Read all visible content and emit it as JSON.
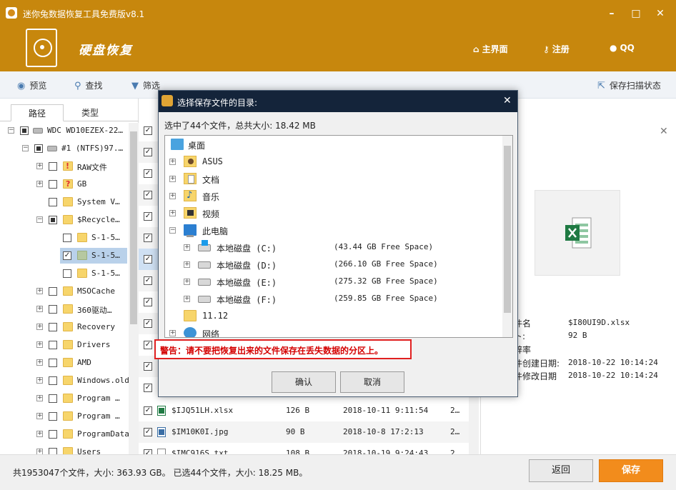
{
  "window": {
    "title": "迷你兔数据恢复工具免费版v8.1",
    "min_glyph": "–",
    "max_glyph": "□",
    "close_glyph": "✕"
  },
  "header": {
    "brand": "硬盘恢复",
    "nav": [
      {
        "label": "主界面",
        "icon": "home-icon"
      },
      {
        "label": "注册",
        "icon": "key-icon"
      },
      {
        "label": "QQ",
        "icon": "qq-icon"
      }
    ]
  },
  "toolbar": {
    "preview": "预览",
    "find": "查找",
    "filter": "筛选",
    "save_scan": "保存扫描状态"
  },
  "left_panel": {
    "tabs": [
      "路径",
      "类型"
    ],
    "tree": [
      {
        "label": "WDC WD10EZEX-22…",
        "level": 0
      },
      {
        "label": "#1 (NTFS)97.…",
        "level": 1
      },
      {
        "label": "RAW文件",
        "level": 2
      },
      {
        "label": "GB",
        "level": 2
      },
      {
        "label": "System V…",
        "level": 2
      },
      {
        "label": "$Recycle…",
        "level": 2
      },
      {
        "label": "S-1-5…",
        "level": 3
      },
      {
        "label": "S-1-5…",
        "level": 3
      },
      {
        "label": "S-1-5…",
        "level": 3
      },
      {
        "label": "MSOCache",
        "level": 2
      },
      {
        "label": "360驱动…",
        "level": 2
      },
      {
        "label": "Recovery",
        "level": 2
      },
      {
        "label": "Drivers",
        "level": 2
      },
      {
        "label": "AMD",
        "level": 2
      },
      {
        "label": "Windows.old",
        "level": 2
      },
      {
        "label": "Program …",
        "level": 2
      },
      {
        "label": "Program …",
        "level": 2
      },
      {
        "label": "ProgramData",
        "level": 2
      },
      {
        "label": "Users",
        "level": 2
      }
    ]
  },
  "file_list": [
    {
      "name": "$IJQ51LH.xlsx",
      "size": "126 B",
      "date": "2018-10-11 9:11:54",
      "extra": "2…"
    },
    {
      "name": "$IM10K0I.jpg",
      "size": "90 B",
      "date": "2018-10-8 17:2:13",
      "extra": "2…"
    },
    {
      "name": "$IMC916S.txt",
      "size": "108 B",
      "date": "2018-10-19 9:24:43",
      "extra": "2…"
    }
  ],
  "preview": {
    "close_glyph": "✕",
    "props": [
      {
        "label": "件名",
        "value": "$I80UI9D.xlsx"
      },
      {
        "label": "ト:",
        "value": "92 B"
      },
      {
        "label": "辞率",
        "value": ""
      },
      {
        "label": "件创建日期:",
        "value": "2018-10-22 10:14:24"
      },
      {
        "label": "件修改日期",
        "value": "2018-10-22 10:14:24"
      }
    ]
  },
  "status": {
    "text": "共1953047个文件，大小: 363.93 GB。 已选44个文件，大小: 18.25 MB。"
  },
  "buttons": {
    "back": "返回",
    "save": "保存"
  },
  "dialog": {
    "title": "选择保存文件的目录:",
    "close_glyph": "✕",
    "info": "选中了44个文件，总共大小: 18.42 MB",
    "tree": [
      {
        "label": "桌面",
        "icon": "desktop-icon",
        "space": ""
      },
      {
        "label": "ASUS",
        "icon": "user-folder-icon",
        "space": ""
      },
      {
        "label": "文档",
        "icon": "documents-folder-icon",
        "space": ""
      },
      {
        "label": "音乐",
        "icon": "music-folder-icon",
        "space": ""
      },
      {
        "label": "视频",
        "icon": "video-folder-icon",
        "space": ""
      },
      {
        "label": "此电脑",
        "icon": "computer-icon",
        "space": ""
      },
      {
        "label": "本地磁盘 (C:)",
        "icon": "system-disk-icon",
        "space": "(43.44 GB Free Space)"
      },
      {
        "label": "本地磁盘 (D:)",
        "icon": "disk-icon",
        "space": "(266.10 GB Free Space)"
      },
      {
        "label": "本地磁盘 (E:)",
        "icon": "disk-icon",
        "space": "(275.32 GB Free Space)"
      },
      {
        "label": "本地磁盘 (F:)",
        "icon": "disk-icon",
        "space": "(259.85 GB Free Space)"
      },
      {
        "label": "11.12",
        "icon": "folder-icon",
        "space": ""
      },
      {
        "label": "网络",
        "icon": "network-icon",
        "space": ""
      }
    ],
    "warning": "警告：请不要把恢复出来的文件保存在丢失数据的分区上。",
    "ok": "确认",
    "cancel": "取消"
  }
}
